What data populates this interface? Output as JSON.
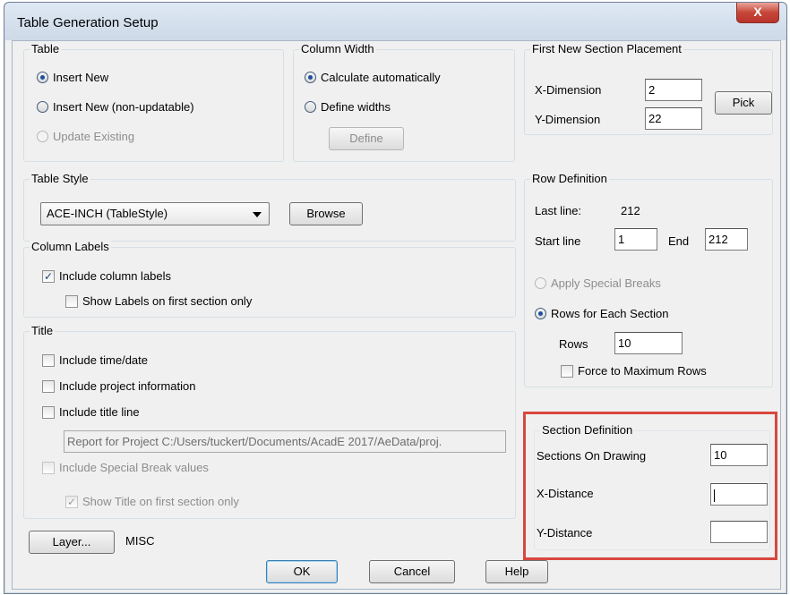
{
  "window": {
    "title": "Table Generation Setup",
    "close_label": "X"
  },
  "table_group": {
    "label": "Table",
    "options": [
      {
        "label": "Insert New",
        "selected": true,
        "enabled": true
      },
      {
        "label": "Insert New (non-updatable)",
        "selected": false,
        "enabled": true
      },
      {
        "label": "Update Existing",
        "selected": false,
        "enabled": false
      }
    ]
  },
  "column_width": {
    "label": "Column Width",
    "options": [
      {
        "label": "Calculate automatically",
        "selected": true
      },
      {
        "label": "Define widths",
        "selected": false
      }
    ],
    "define_button": "Define"
  },
  "first_section": {
    "label": "First New Section Placement",
    "x_label": "X-Dimension",
    "x_value": "2",
    "y_label": "Y-Dimension",
    "y_value": "22",
    "pick_button": "Pick"
  },
  "table_style": {
    "label": "Table Style",
    "selected": "ACE-INCH  (TableStyle)",
    "browse_button": "Browse"
  },
  "column_labels": {
    "label": "Column Labels",
    "include_label": "Include column labels",
    "include_checked": true,
    "show_first_label": "Show Labels on first section only",
    "show_first_checked": false
  },
  "title_group": {
    "label": "Title",
    "time_date": "Include time/date",
    "project_info": "Include project information",
    "title_line": "Include title line",
    "title_value": "Report for Project C:/Users/tuckert/Documents/AcadE 2017/AeData/proj.",
    "special_break": "Include Special Break values",
    "show_title_first": "Show Title on first section only",
    "show_title_first_checked": true
  },
  "row_definition": {
    "label": "Row Definition",
    "last_line_label": "Last line:",
    "last_line_value": "212",
    "start_label": "Start line",
    "start_value": "1",
    "end_label": "End",
    "end_value": "212",
    "apply_breaks": "Apply Special Breaks",
    "rows_each": "Rows for Each Section",
    "rows_label": "Rows",
    "rows_value": "10",
    "force_max": "Force to Maximum Rows"
  },
  "section_definition": {
    "label": "Section Definition",
    "sections_label": "Sections On Drawing",
    "sections_value": "10",
    "x_label": "X-Distance",
    "x_value": "",
    "y_label": "Y-Distance",
    "y_value": ""
  },
  "footer": {
    "layer_button": "Layer...",
    "layer_value": "MISC",
    "ok": "OK",
    "cancel": "Cancel",
    "help": "Help"
  },
  "colors": {
    "highlight": "#d9473f",
    "titlebar": "#cdd9e7",
    "close": "#c7463a"
  }
}
